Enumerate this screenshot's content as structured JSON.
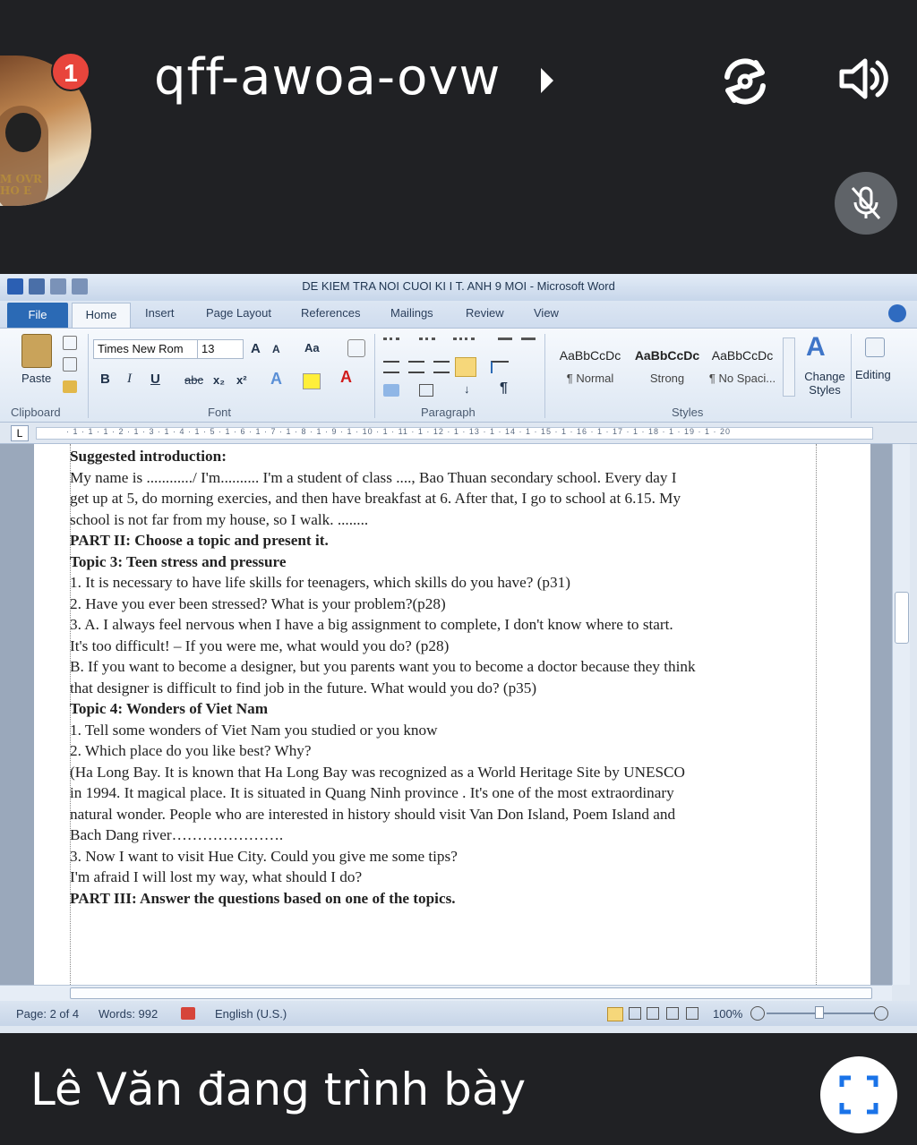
{
  "call": {
    "meeting_code": "qff-awoa-ovw",
    "notification_count": "1",
    "avatar_caption_line1": "M OVR",
    "avatar_caption_line2": "HO E",
    "presenter_status": "Lê Văn đang trình bày"
  },
  "icons": {
    "expand": "play-triangle-icon",
    "rotate": "rotate-camera-icon",
    "volume": "volume-icon",
    "mic": "mic-muted-icon",
    "fullscreen": "fullscreen-icon"
  },
  "word": {
    "title": "DE KIEM TRA NOI CUOI KI I T. ANH 9 MOI  -  Microsoft Word",
    "tabs": [
      "File",
      "Home",
      "Insert",
      "Page Layout",
      "References",
      "Mailings",
      "Review",
      "View"
    ],
    "ribbon": {
      "paste_label": "Paste",
      "font_name": "Times New Rom",
      "font_size": "13",
      "clipboard_label": "Clipboard",
      "font_label": "Font",
      "paragraph_label": "Paragraph",
      "styles_label": "Styles",
      "change_styles_label": "Change Styles",
      "editing_label": "Editing",
      "style_items": [
        {
          "preview": "AaBbCcDc",
          "name": "¶ Normal"
        },
        {
          "preview": "AaBbCcDc",
          "name": "Strong"
        },
        {
          "preview": "AaBbCcDc",
          "name": "¶ No Spaci..."
        }
      ]
    },
    "ruler_numbers": "· 1 · 1 · 1 · 2 · 1 · 3 · 1 · 4 · 1 · 5 · 1 · 6 · 1 · 7 · 1 · 8 · 1 · 9 · 1 · 10 · 1 · 11 · 1 · 12 · 1 · 13 · 1 · 14 · 1 · 15 · 1 · 16 · 1 · 17 · 1 · 18 · 1 · 19 · 1 · 20",
    "document_lines": [
      {
        "text": "Suggested introduction:",
        "bold": true
      },
      {
        "text": "My name is ............/ I'm.......... I'm a student of class ...., Bao Thuan secondary school. Every day I",
        "bold": false
      },
      {
        "text": "get up at 5, do morning exercies, and then have breakfast at 6. After that, I go to school at 6.15. My",
        "bold": false
      },
      {
        "text": "school is not far from my house, so I walk. ........",
        "bold": false
      },
      {
        "text": "PART II: Choose a topic and present it.",
        "bold": true
      },
      {
        "text": "Topic 3: Teen stress and pressure",
        "bold": true
      },
      {
        "text": "1. It is necessary to have  life skills for teenagers, which skills do you have? (p31)",
        "bold": false
      },
      {
        "text": "2. Have you ever been stressed? What is your problem?(p28)",
        "bold": false
      },
      {
        "text": "3. A. I always feel nervous when I have a big assignment to complete, I don't know where to start.",
        "bold": false
      },
      {
        "text": "It's too difficult! – If you were me, what would you do? (p28)",
        "bold": false
      },
      {
        "text": "B. If you want to become a designer, but you parents want you to become a doctor because they think",
        "bold": false
      },
      {
        "text": "that designer is difficult to find job in the future. What would you do? (p35)",
        "bold": false
      },
      {
        "text": "Topic 4: Wonders of Viet Nam",
        "bold": true
      },
      {
        "text": "1. Tell some wonders of Viet Nam you studied or you know",
        "bold": false
      },
      {
        "text": "2. Which place do you like best? Why?",
        "bold": false
      },
      {
        "text": "(Ha Long Bay. It is known that Ha Long Bay was recognized as a World Heritage Site by UNESCO",
        "bold": false
      },
      {
        "text": "in 1994. It magical place. It is situated in Quang Ninh province . It's one of the most extraordinary",
        "bold": false
      },
      {
        "text": "natural wonder. People who are interested in history should visit Van Don Island, Poem Island and",
        "bold": false
      },
      {
        "text": "Bach Dang river………………….",
        "bold": false
      },
      {
        "text": "3. Now I want to visit Hue City. Could you give me some tips?",
        "bold": false
      },
      {
        "text": "I'm afraid I will lost my way, what should I do?",
        "bold": false
      },
      {
        "text": "PART III: Answer the questions based on one of the topics.",
        "bold": true
      }
    ],
    "status": {
      "page": "Page: 2 of 4",
      "words": "Words: 992",
      "language": "English (U.S.)",
      "zoom": "100%"
    }
  }
}
